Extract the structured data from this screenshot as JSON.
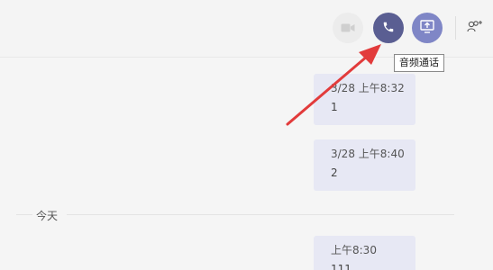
{
  "header": {
    "buttons": [
      {
        "name": "video-call",
        "icon": "video-camera-icon",
        "enabled": false
      },
      {
        "name": "audio-call",
        "icon": "phone-icon",
        "enabled": true
      },
      {
        "name": "share-screen",
        "icon": "share-screen-icon",
        "enabled": true
      }
    ],
    "add_people_icon": "add-people-icon",
    "tooltip": "音频通话"
  },
  "messages": [
    {
      "time": "3/28 上午8:32",
      "text": "1"
    },
    {
      "time": "3/28 上午8:40",
      "text": "2"
    },
    {
      "time": "上午8:30",
      "text": "111"
    }
  ],
  "day_separator": "今天",
  "colors": {
    "call_button": "#5a5e92",
    "share_button": "#7f86c6",
    "bubble": "#e7e8f4",
    "arrow": "#e23b3b"
  }
}
